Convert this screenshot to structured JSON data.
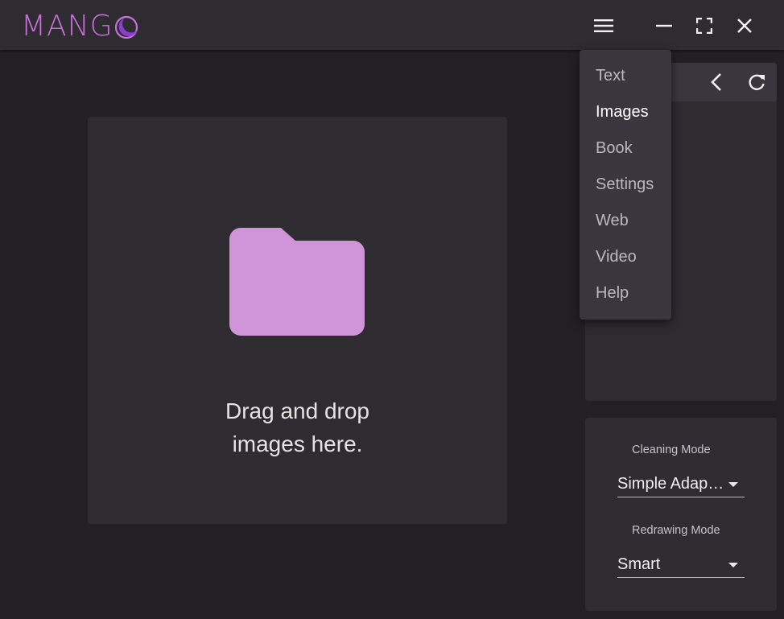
{
  "app": {
    "logo_text": "MANG",
    "logo_o_icon": "crescent-o-logo",
    "accent_color": "#c870d8"
  },
  "titlebar": {
    "menu_icon": "hamburger-menu-icon",
    "minimize_icon": "minimize-icon",
    "maximize_icon": "fullscreen-icon",
    "close_icon": "close-icon"
  },
  "menu": {
    "items": [
      {
        "label": "Text"
      },
      {
        "label": "Images",
        "active": true
      },
      {
        "label": "Book"
      },
      {
        "label": "Settings"
      },
      {
        "label": "Web"
      },
      {
        "label": "Video"
      },
      {
        "label": "Help"
      }
    ]
  },
  "dropzone": {
    "icon": "folder-icon",
    "icon_color": "#d094d8",
    "text": "Drag and drop\nimages here."
  },
  "side_panel": {
    "back_icon": "chevron-left-icon",
    "refresh_icon": "refresh-icon"
  },
  "settings": {
    "cleaning_mode_label": "Cleaning Mode",
    "cleaning_mode_value": "Simple Adap…",
    "redrawing_mode_label": "Redrawing Mode",
    "redrawing_mode_value": "Smart"
  }
}
